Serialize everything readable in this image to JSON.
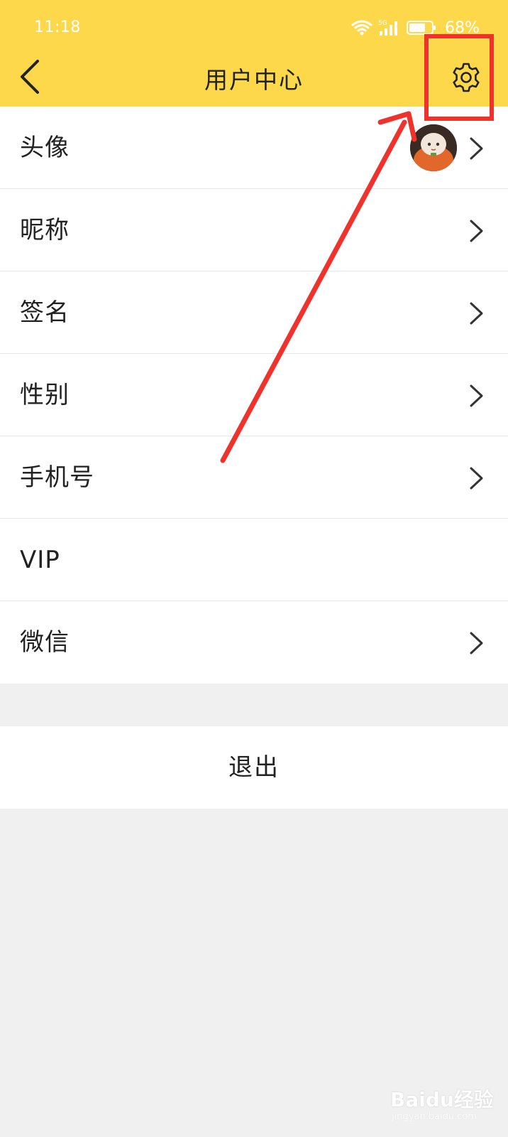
{
  "status_bar": {
    "time": "11:18",
    "network": "5G",
    "battery": "68%"
  },
  "header": {
    "title": "用户中心",
    "background_color": "#fdd84a",
    "back_icon": "chevron-left-icon",
    "settings_icon": "gear-icon"
  },
  "list": {
    "items": [
      {
        "label": "头像",
        "has_chevron": true
      },
      {
        "label": "昵称",
        "has_chevron": true
      },
      {
        "label": "签名",
        "has_chevron": true
      },
      {
        "label": "性别",
        "has_chevron": true
      },
      {
        "label": "手机号",
        "has_chevron": true
      },
      {
        "label": "VIP",
        "has_chevron": false
      },
      {
        "label": "微信",
        "has_chevron": true
      }
    ]
  },
  "logout": {
    "label": "退出"
  },
  "annotation": {
    "color": "#f0322d"
  },
  "watermark": {
    "brand": "Baidu经验",
    "url": "jingyan.baidu.com"
  }
}
